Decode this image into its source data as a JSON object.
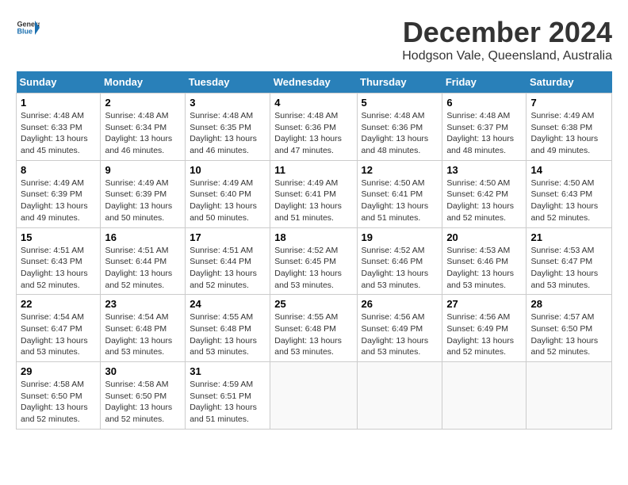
{
  "logo": {
    "line1": "General",
    "line2": "Blue"
  },
  "title": "December 2024",
  "subtitle": "Hodgson Vale, Queensland, Australia",
  "header": {
    "days": [
      "Sunday",
      "Monday",
      "Tuesday",
      "Wednesday",
      "Thursday",
      "Friday",
      "Saturday"
    ]
  },
  "weeks": [
    [
      {
        "day": "1",
        "sunrise": "Sunrise: 4:48 AM",
        "sunset": "Sunset: 6:33 PM",
        "daylight": "Daylight: 13 hours and 45 minutes."
      },
      {
        "day": "2",
        "sunrise": "Sunrise: 4:48 AM",
        "sunset": "Sunset: 6:34 PM",
        "daylight": "Daylight: 13 hours and 46 minutes."
      },
      {
        "day": "3",
        "sunrise": "Sunrise: 4:48 AM",
        "sunset": "Sunset: 6:35 PM",
        "daylight": "Daylight: 13 hours and 46 minutes."
      },
      {
        "day": "4",
        "sunrise": "Sunrise: 4:48 AM",
        "sunset": "Sunset: 6:36 PM",
        "daylight": "Daylight: 13 hours and 47 minutes."
      },
      {
        "day": "5",
        "sunrise": "Sunrise: 4:48 AM",
        "sunset": "Sunset: 6:36 PM",
        "daylight": "Daylight: 13 hours and 48 minutes."
      },
      {
        "day": "6",
        "sunrise": "Sunrise: 4:48 AM",
        "sunset": "Sunset: 6:37 PM",
        "daylight": "Daylight: 13 hours and 48 minutes."
      },
      {
        "day": "7",
        "sunrise": "Sunrise: 4:49 AM",
        "sunset": "Sunset: 6:38 PM",
        "daylight": "Daylight: 13 hours and 49 minutes."
      }
    ],
    [
      {
        "day": "8",
        "sunrise": "Sunrise: 4:49 AM",
        "sunset": "Sunset: 6:39 PM",
        "daylight": "Daylight: 13 hours and 49 minutes."
      },
      {
        "day": "9",
        "sunrise": "Sunrise: 4:49 AM",
        "sunset": "Sunset: 6:39 PM",
        "daylight": "Daylight: 13 hours and 50 minutes."
      },
      {
        "day": "10",
        "sunrise": "Sunrise: 4:49 AM",
        "sunset": "Sunset: 6:40 PM",
        "daylight": "Daylight: 13 hours and 50 minutes."
      },
      {
        "day": "11",
        "sunrise": "Sunrise: 4:49 AM",
        "sunset": "Sunset: 6:41 PM",
        "daylight": "Daylight: 13 hours and 51 minutes."
      },
      {
        "day": "12",
        "sunrise": "Sunrise: 4:50 AM",
        "sunset": "Sunset: 6:41 PM",
        "daylight": "Daylight: 13 hours and 51 minutes."
      },
      {
        "day": "13",
        "sunrise": "Sunrise: 4:50 AM",
        "sunset": "Sunset: 6:42 PM",
        "daylight": "Daylight: 13 hours and 52 minutes."
      },
      {
        "day": "14",
        "sunrise": "Sunrise: 4:50 AM",
        "sunset": "Sunset: 6:43 PM",
        "daylight": "Daylight: 13 hours and 52 minutes."
      }
    ],
    [
      {
        "day": "15",
        "sunrise": "Sunrise: 4:51 AM",
        "sunset": "Sunset: 6:43 PM",
        "daylight": "Daylight: 13 hours and 52 minutes."
      },
      {
        "day": "16",
        "sunrise": "Sunrise: 4:51 AM",
        "sunset": "Sunset: 6:44 PM",
        "daylight": "Daylight: 13 hours and 52 minutes."
      },
      {
        "day": "17",
        "sunrise": "Sunrise: 4:51 AM",
        "sunset": "Sunset: 6:44 PM",
        "daylight": "Daylight: 13 hours and 52 minutes."
      },
      {
        "day": "18",
        "sunrise": "Sunrise: 4:52 AM",
        "sunset": "Sunset: 6:45 PM",
        "daylight": "Daylight: 13 hours and 53 minutes."
      },
      {
        "day": "19",
        "sunrise": "Sunrise: 4:52 AM",
        "sunset": "Sunset: 6:46 PM",
        "daylight": "Daylight: 13 hours and 53 minutes."
      },
      {
        "day": "20",
        "sunrise": "Sunrise: 4:53 AM",
        "sunset": "Sunset: 6:46 PM",
        "daylight": "Daylight: 13 hours and 53 minutes."
      },
      {
        "day": "21",
        "sunrise": "Sunrise: 4:53 AM",
        "sunset": "Sunset: 6:47 PM",
        "daylight": "Daylight: 13 hours and 53 minutes."
      }
    ],
    [
      {
        "day": "22",
        "sunrise": "Sunrise: 4:54 AM",
        "sunset": "Sunset: 6:47 PM",
        "daylight": "Daylight: 13 hours and 53 minutes."
      },
      {
        "day": "23",
        "sunrise": "Sunrise: 4:54 AM",
        "sunset": "Sunset: 6:48 PM",
        "daylight": "Daylight: 13 hours and 53 minutes."
      },
      {
        "day": "24",
        "sunrise": "Sunrise: 4:55 AM",
        "sunset": "Sunset: 6:48 PM",
        "daylight": "Daylight: 13 hours and 53 minutes."
      },
      {
        "day": "25",
        "sunrise": "Sunrise: 4:55 AM",
        "sunset": "Sunset: 6:48 PM",
        "daylight": "Daylight: 13 hours and 53 minutes."
      },
      {
        "day": "26",
        "sunrise": "Sunrise: 4:56 AM",
        "sunset": "Sunset: 6:49 PM",
        "daylight": "Daylight: 13 hours and 53 minutes."
      },
      {
        "day": "27",
        "sunrise": "Sunrise: 4:56 AM",
        "sunset": "Sunset: 6:49 PM",
        "daylight": "Daylight: 13 hours and 52 minutes."
      },
      {
        "day": "28",
        "sunrise": "Sunrise: 4:57 AM",
        "sunset": "Sunset: 6:50 PM",
        "daylight": "Daylight: 13 hours and 52 minutes."
      }
    ],
    [
      {
        "day": "29",
        "sunrise": "Sunrise: 4:58 AM",
        "sunset": "Sunset: 6:50 PM",
        "daylight": "Daylight: 13 hours and 52 minutes."
      },
      {
        "day": "30",
        "sunrise": "Sunrise: 4:58 AM",
        "sunset": "Sunset: 6:50 PM",
        "daylight": "Daylight: 13 hours and 52 minutes."
      },
      {
        "day": "31",
        "sunrise": "Sunrise: 4:59 AM",
        "sunset": "Sunset: 6:51 PM",
        "daylight": "Daylight: 13 hours and 51 minutes."
      },
      null,
      null,
      null,
      null
    ]
  ]
}
